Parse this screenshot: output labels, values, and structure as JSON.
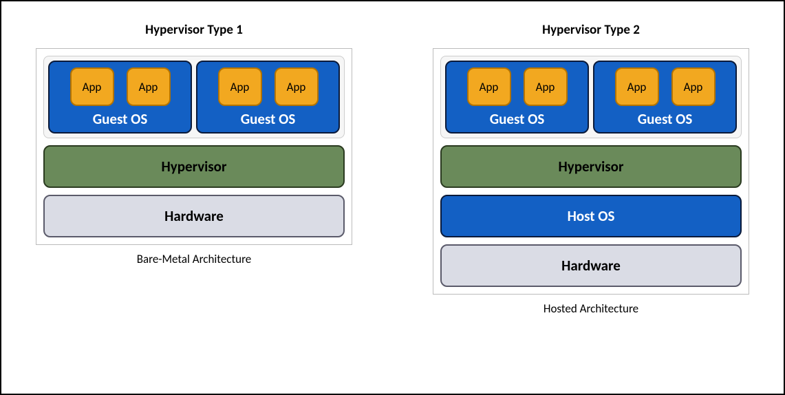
{
  "type1": {
    "title": "Hypervisor Type 1",
    "caption": "Bare-Metal Architecture",
    "guests": [
      {
        "label": "Guest OS",
        "apps": [
          "App",
          "App"
        ]
      },
      {
        "label": "Guest OS",
        "apps": [
          "App",
          "App"
        ]
      }
    ],
    "layers": {
      "hypervisor": "Hypervisor",
      "hardware": "Hardware"
    }
  },
  "type2": {
    "title": "Hypervisor Type 2",
    "caption": "Hosted Architecture",
    "guests": [
      {
        "label": "Guest OS",
        "apps": [
          "App",
          "App"
        ]
      },
      {
        "label": "Guest OS",
        "apps": [
          "App",
          "App"
        ]
      }
    ],
    "layers": {
      "hypervisor": "Hypervisor",
      "hostos": "Host OS",
      "hardware": "Hardware"
    }
  }
}
